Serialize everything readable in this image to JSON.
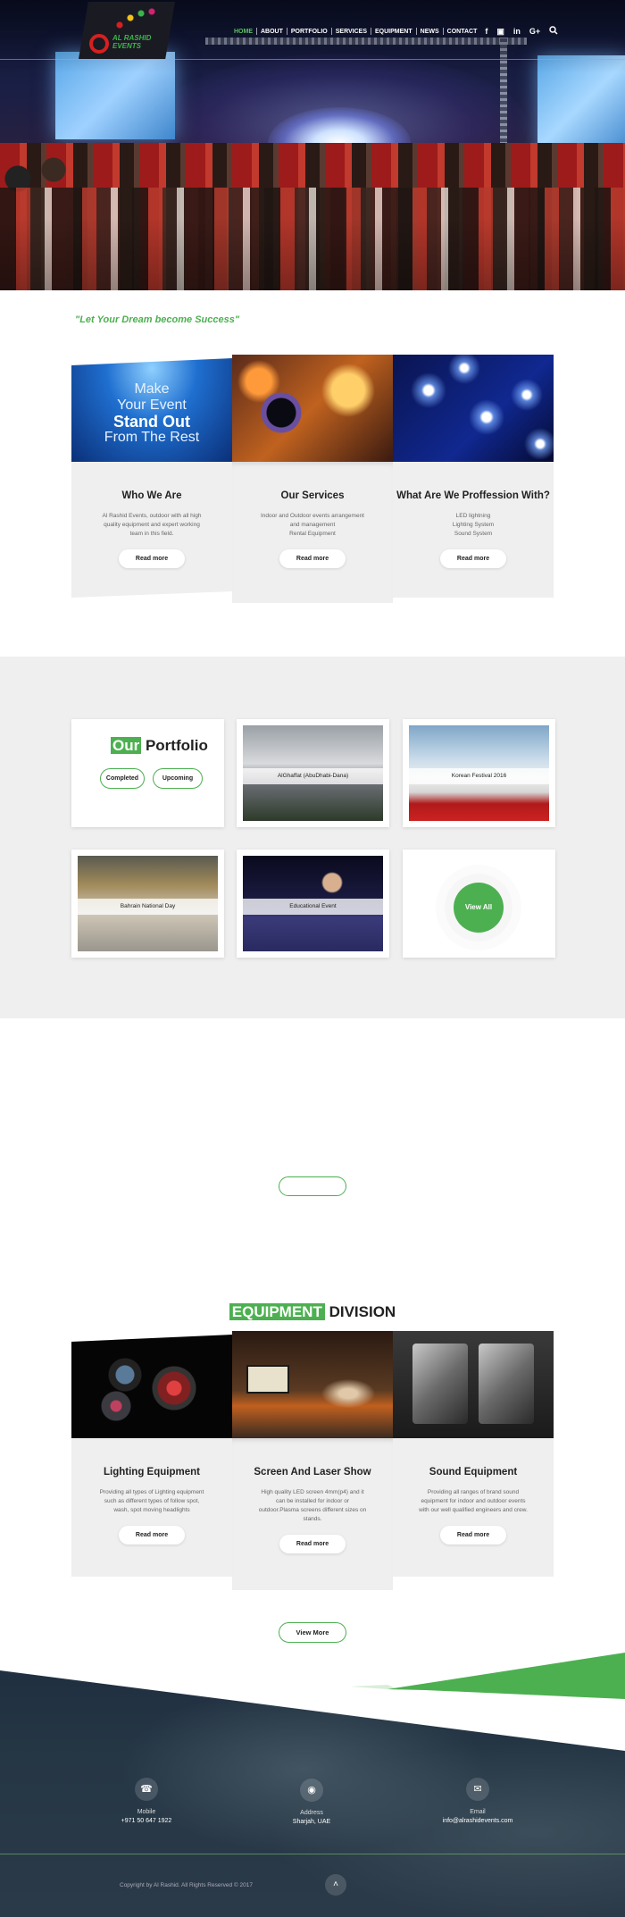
{
  "brand": {
    "logo_text": "AL RASHID EVENTS"
  },
  "nav": {
    "items": [
      "HOME",
      "ABOUT",
      "PORTFOLIO",
      "SERVICES",
      "EQUIPMENT",
      "NEWS",
      "CONTACT"
    ],
    "social_icons": [
      "facebook-icon",
      "instagram-icon",
      "linkedin-icon",
      "google-plus-icon"
    ],
    "social_glyphs": [
      "f",
      "▣",
      "in",
      "G+"
    ],
    "search_icon": "search-icon",
    "accent": "#4cb050"
  },
  "tagline": "\"Let Your Dream become Success\"",
  "intro": {
    "banner_lines": [
      "Make",
      "Your Event",
      "Stand Out",
      "From The Rest"
    ],
    "cards": [
      {
        "title": "Who We Are",
        "desc": [
          "Al Rashid Events, outdoor with all high",
          "quality equipment and expert working",
          "team in this field."
        ],
        "button": "Read more"
      },
      {
        "title": "Our Services",
        "desc": [
          "Indoor and Outdoor events arrangement",
          "and management",
          "Rental Equipment"
        ],
        "button": "Read more"
      },
      {
        "title": "What Are We Proffession With?",
        "desc": [
          "LED lightning",
          "Lighting System",
          "Sound System"
        ],
        "button": "Read more"
      }
    ]
  },
  "portfolio": {
    "title_highlight": "Our",
    "title_rest": " Portfolio",
    "filters": [
      "Completed",
      "Upcoming"
    ],
    "items": [
      "AlGhaffat (AbuDhabi-Dana)",
      "Korean Festival 2016",
      "Bahrain National Day",
      "Educational Event"
    ],
    "view_all": "View All"
  },
  "equipment": {
    "title_highlight": "EQUIPMENT",
    "title_rest": " DIVISION",
    "cards": [
      {
        "title": "Lighting Equipment",
        "desc": [
          "Providing all types of Lighting equipment",
          "such as different types of follow spot,",
          "wash, spot moving headlights"
        ],
        "button": "Read more"
      },
      {
        "title": "Screen And Laser Show",
        "desc": [
          "High quality LED screen 4mm(p4) and it",
          "can be installed for indoor or",
          "outdoor.Plasma screens different sizes on",
          "stands."
        ],
        "button": "Read more"
      },
      {
        "title": "Sound Equipment",
        "desc": [
          "Providing all ranges of brand sound",
          "equipment for indoor and outdoor events",
          "with our well qualified engineers and crew."
        ],
        "button": "Read more"
      }
    ],
    "view_more": "View More"
  },
  "footer": {
    "contacts": [
      {
        "icon": "phone-icon",
        "glyph": "☎",
        "label": "Mobile",
        "value": "+971 50 647 1922"
      },
      {
        "icon": "location-pin-icon",
        "glyph": "◉",
        "label": "Address",
        "value": "Sharjah, UAE"
      },
      {
        "icon": "envelope-icon",
        "glyph": "✉",
        "label": "Email",
        "value": "info@alrashidevents.com"
      }
    ],
    "copyright": "Copyright by Al Rashid. All Rights Reserved © 2017",
    "back_to_top_glyph": "˄"
  }
}
